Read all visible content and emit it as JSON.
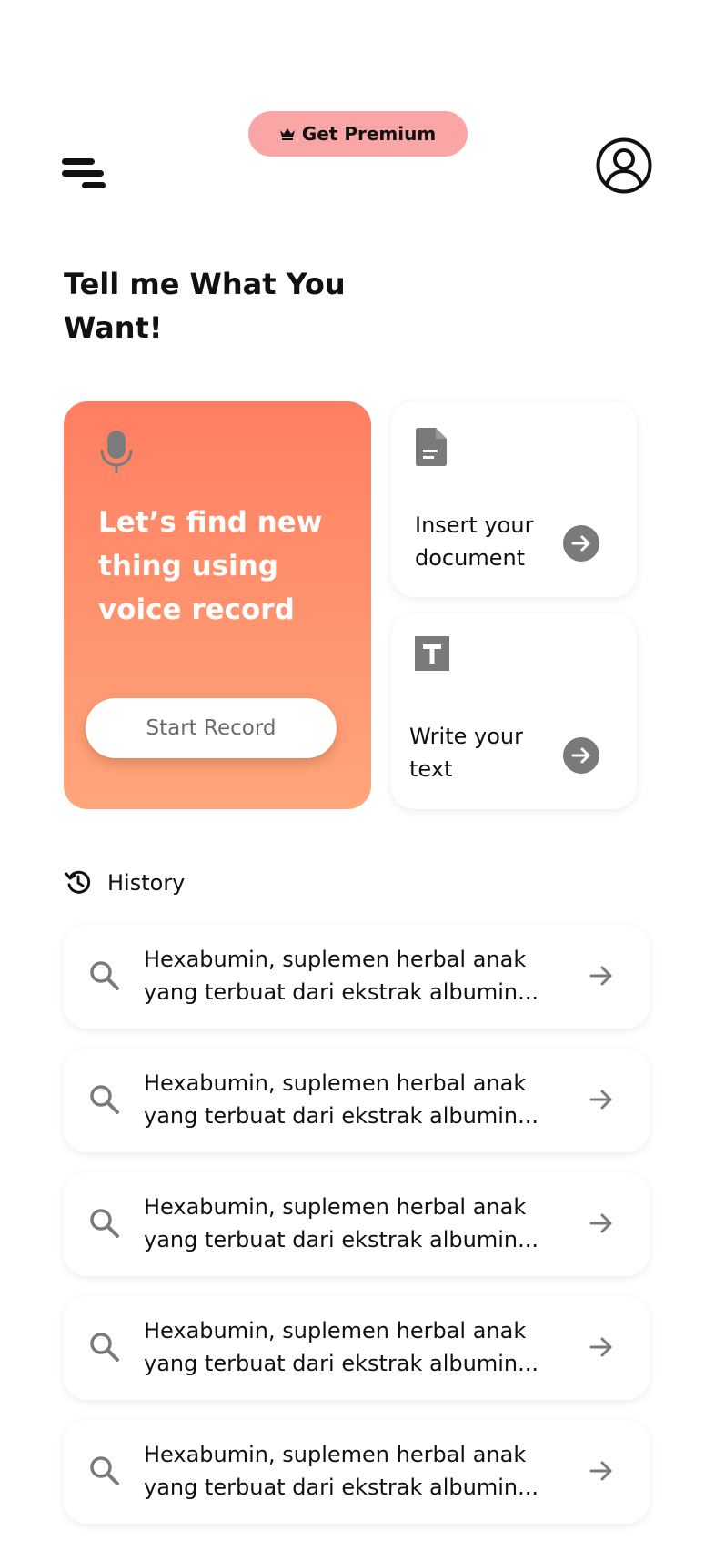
{
  "header": {
    "menu_icon": "menu-icon",
    "premium_label": "Get Premium",
    "premium_icon": "crown-icon",
    "premium_color": "#fba6a6",
    "profile_icon": "user-circle-icon"
  },
  "heading": "Tell me What You Want!",
  "voice_card": {
    "icon": "microphone-icon",
    "text": "Let’s find new thing using voice record",
    "button_label": "Start Record",
    "gradient_top": "#ff7e61",
    "gradient_bottom": "#ffa67b"
  },
  "options": [
    {
      "label": "Insert your document",
      "icon": "document-icon",
      "arrow_icon": "arrow-circle-icon"
    },
    {
      "label": "Write your text",
      "icon": "text-icon",
      "arrow_icon": "arrow-circle-icon"
    }
  ],
  "history": {
    "label": "History",
    "icon": "history-icon",
    "items": [
      {
        "text": "Hexabumin, suplemen herbal anak yang terbuat dari ekstrak albumin..."
      },
      {
        "text": "Hexabumin, suplemen herbal anak yang terbuat dari ekstrak albumin..."
      },
      {
        "text": "Hexabumin, suplemen herbal anak yang terbuat dari ekstrak albumin..."
      },
      {
        "text": "Hexabumin, suplemen herbal anak yang terbuat dari ekstrak albumin..."
      },
      {
        "text": "Hexabumin, suplemen herbal anak yang terbuat dari ekstrak albumin..."
      }
    ]
  }
}
